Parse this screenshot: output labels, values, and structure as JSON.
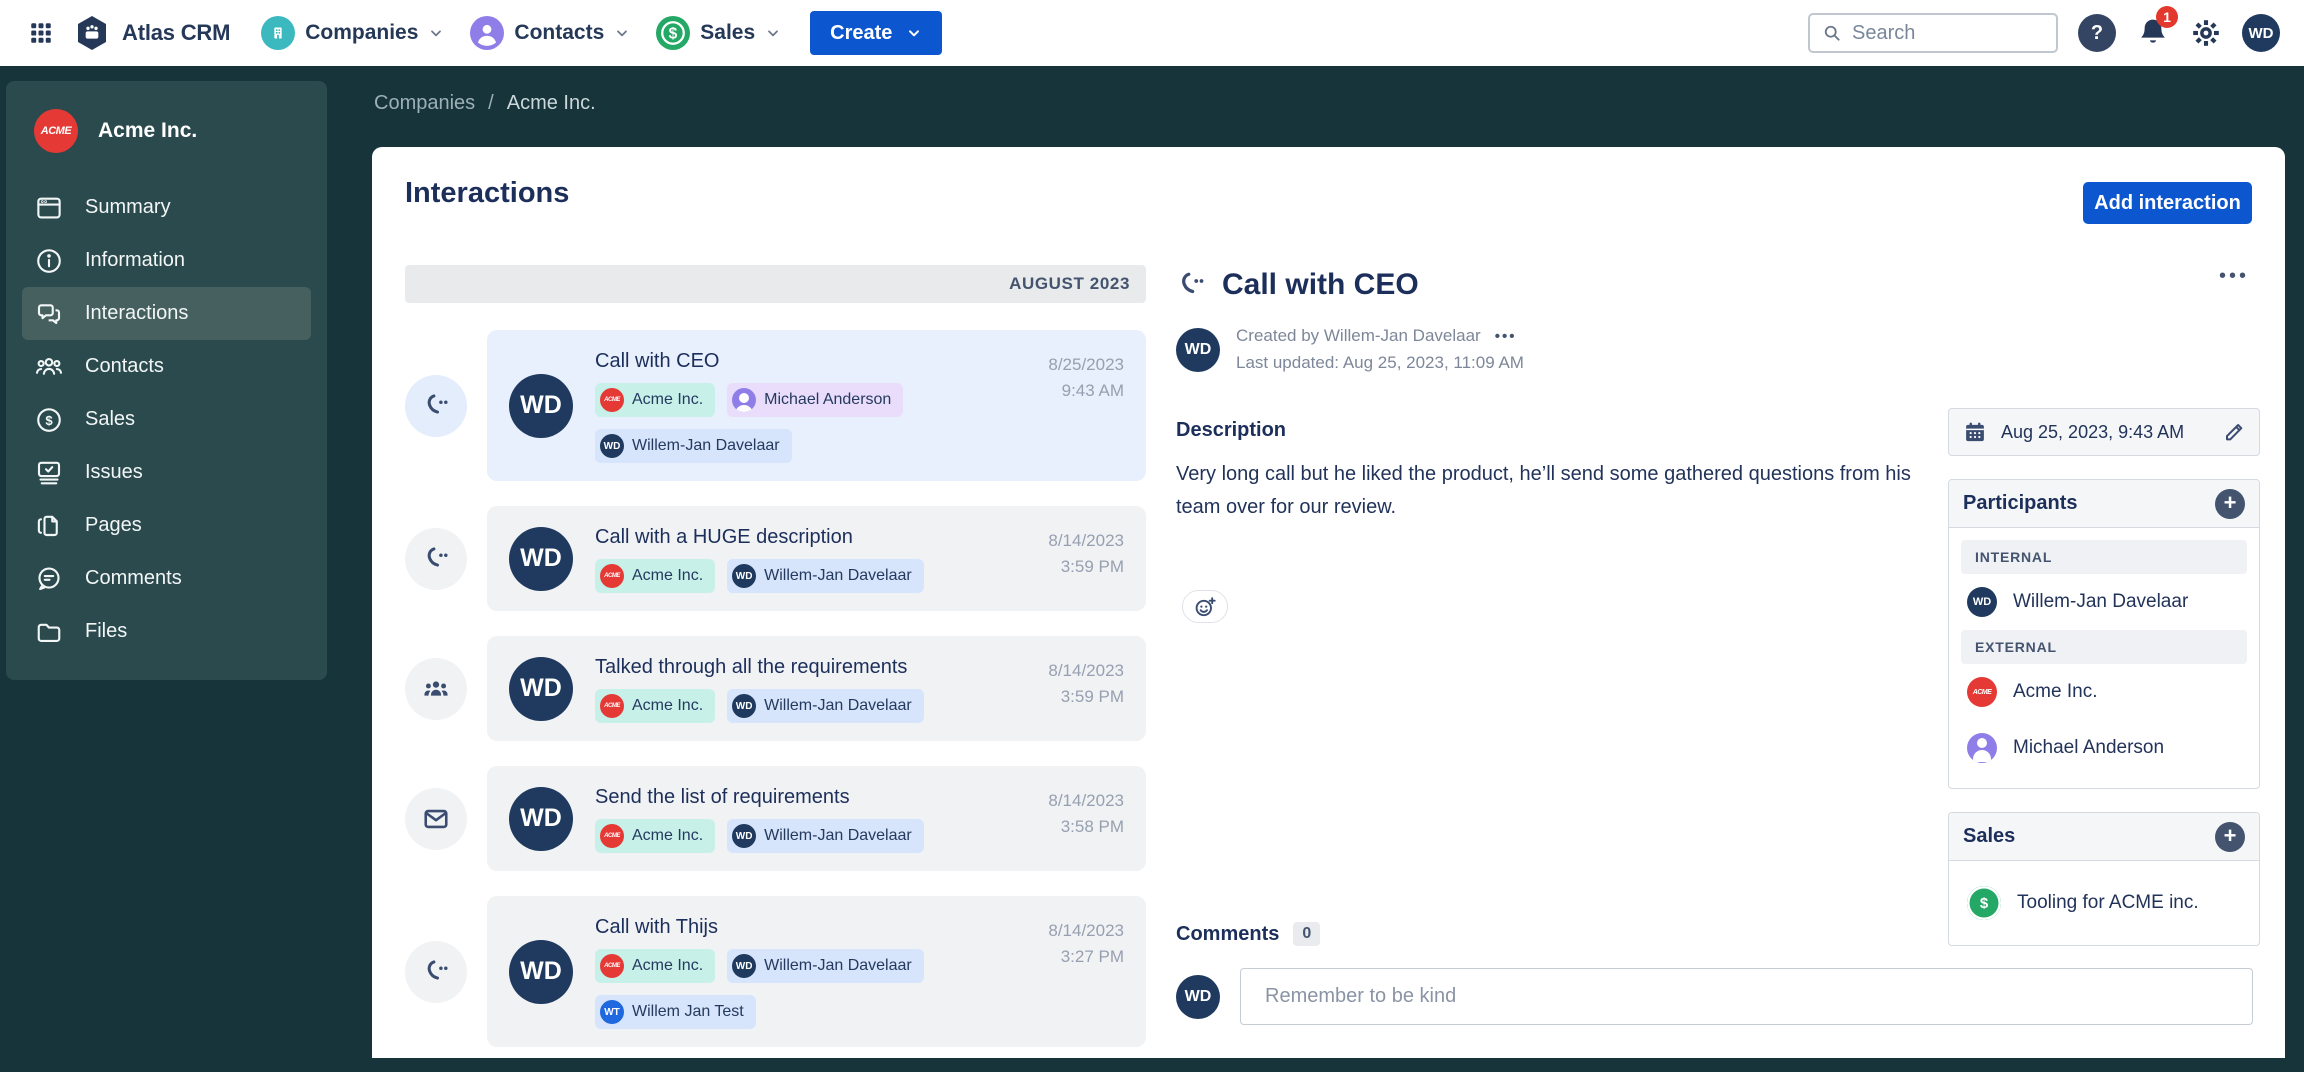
{
  "navbar": {
    "app_name": "Atlas CRM",
    "menu_companies": "Companies",
    "menu_contacts": "Contacts",
    "menu_sales": "Sales",
    "create_label": "Create",
    "search_placeholder": "Search",
    "help_glyph": "?",
    "notification_count": "1",
    "user_initials": "WD"
  },
  "sidebar": {
    "company_name": "Acme Inc.",
    "company_logo_text": "ACME",
    "items": [
      {
        "label": "Summary"
      },
      {
        "label": "Information"
      },
      {
        "label": "Interactions"
      },
      {
        "label": "Contacts"
      },
      {
        "label": "Sales"
      },
      {
        "label": "Issues"
      },
      {
        "label": "Pages"
      },
      {
        "label": "Comments"
      },
      {
        "label": "Files"
      }
    ]
  },
  "breadcrumb": {
    "parent": "Companies",
    "separator": "/",
    "current": "Acme Inc."
  },
  "main": {
    "title": "Interactions",
    "add_button": "Add interaction",
    "month_header": "AUGUST 2023",
    "timeline": [
      {
        "title": "Call with CEO",
        "date": "8/25/2023",
        "time": "9:43 AM",
        "avatar": "WD",
        "tags": [
          {
            "label": "Acme Inc.",
            "logo": "ACME"
          },
          {
            "label": "Michael Anderson"
          },
          {
            "label": "Willem-Jan Davelaar",
            "initials": "WD"
          }
        ]
      },
      {
        "title": "Call with a HUGE description",
        "date": "8/14/2023",
        "time": "3:59 PM",
        "avatar": "WD",
        "tags": [
          {
            "label": "Acme Inc.",
            "logo": "ACME"
          },
          {
            "label": "Willem-Jan Davelaar",
            "initials": "WD"
          }
        ]
      },
      {
        "title": "Talked through all the requirements",
        "date": "8/14/2023",
        "time": "3:59 PM",
        "avatar": "WD",
        "tags": [
          {
            "label": "Acme Inc.",
            "logo": "ACME"
          },
          {
            "label": "Willem-Jan Davelaar",
            "initials": "WD"
          }
        ]
      },
      {
        "title": "Send the list of requirements",
        "date": "8/14/2023",
        "time": "3:58 PM",
        "avatar": "WD",
        "tags": [
          {
            "label": "Acme Inc.",
            "logo": "ACME"
          },
          {
            "label": "Willem-Jan Davelaar",
            "initials": "WD"
          }
        ]
      },
      {
        "title": "Call with Thijs",
        "date": "8/14/2023",
        "time": "3:27 PM",
        "avatar": "WD",
        "tags": [
          {
            "label": "Acme Inc.",
            "logo": "ACME"
          },
          {
            "label": "Willem-Jan Davelaar",
            "initials": "WD"
          },
          {
            "label": "Willem Jan Test",
            "initials": "WT"
          }
        ]
      }
    ]
  },
  "detail": {
    "title": "Call with CEO",
    "more_glyph": "•••",
    "avatar": "WD",
    "created_by": "Created by Willem-Jan Davelaar",
    "byline_more": "•••",
    "last_updated": "Last updated: Aug 25, 2023, 11:09 AM",
    "description_heading": "Description",
    "description_text": "Very long call but he liked the product, he’ll send some gathered questions from his team over for our review.",
    "datetime": "Aug 25, 2023, 9:43 AM",
    "participants": {
      "title": "Participants",
      "add_glyph": "+",
      "internal_label": "INTERNAL",
      "internal": [
        {
          "name": "Willem-Jan Davelaar",
          "initials": "WD"
        }
      ],
      "external_label": "EXTERNAL",
      "external": [
        {
          "name": "Acme Inc.",
          "logo": "ACME"
        },
        {
          "name": "Michael Anderson"
        }
      ]
    },
    "sales": {
      "title": "Sales",
      "add_glyph": "+",
      "items": [
        {
          "name": "Tooling for ACME inc."
        }
      ]
    },
    "comments": {
      "title": "Comments",
      "count": "0",
      "avatar": "WD",
      "placeholder": "Remember to be kind"
    }
  },
  "colors": {
    "accent_blue": "#0C56D0",
    "navy_text": "#1C2E5A",
    "page_background": "#16343A",
    "sidebar_panel": "#2B4A4E",
    "badge_red": "#E3382D",
    "companies_teal": "#3CB9BF",
    "contacts_purple": "#8F7EE7",
    "sales_green": "#24A865",
    "acme_red": "#E53935",
    "avatar_navy": "#1F3A5E"
  }
}
